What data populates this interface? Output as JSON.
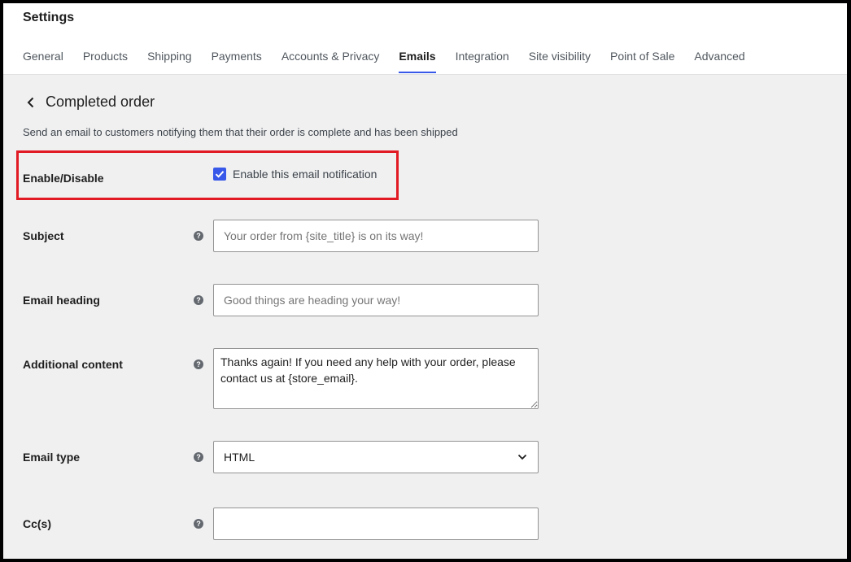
{
  "app": {
    "title": "Settings"
  },
  "tabs": [
    {
      "label": "General",
      "active": false
    },
    {
      "label": "Products",
      "active": false
    },
    {
      "label": "Shipping",
      "active": false
    },
    {
      "label": "Payments",
      "active": false
    },
    {
      "label": "Accounts & Privacy",
      "active": false
    },
    {
      "label": "Emails",
      "active": true
    },
    {
      "label": "Integration",
      "active": false
    },
    {
      "label": "Site visibility",
      "active": false
    },
    {
      "label": "Point of Sale",
      "active": false
    },
    {
      "label": "Advanced",
      "active": false
    }
  ],
  "page": {
    "back_icon": "chevron-left-icon",
    "heading": "Completed order",
    "description": "Send an email to customers notifying them that their order is complete and has been shipped"
  },
  "fields": {
    "enable": {
      "label": "Enable/Disable",
      "checkbox_label": "Enable this email notification",
      "checked": true
    },
    "subject": {
      "label": "Subject",
      "value": "",
      "placeholder": "Your order from {site_title} is on its way!"
    },
    "heading": {
      "label": "Email heading",
      "value": "",
      "placeholder": "Good things are heading your way!"
    },
    "additional": {
      "label": "Additional content",
      "value": "Thanks again! If you need any help with your order, please contact us at {store_email}."
    },
    "email_type": {
      "label": "Email type",
      "value": "HTML"
    },
    "cc": {
      "label": "Cc(s)",
      "value": ""
    },
    "help_icon": "?"
  },
  "colors": {
    "accent": "#3858e9",
    "highlight": "#e11a23",
    "background": "#f0f0f1"
  }
}
